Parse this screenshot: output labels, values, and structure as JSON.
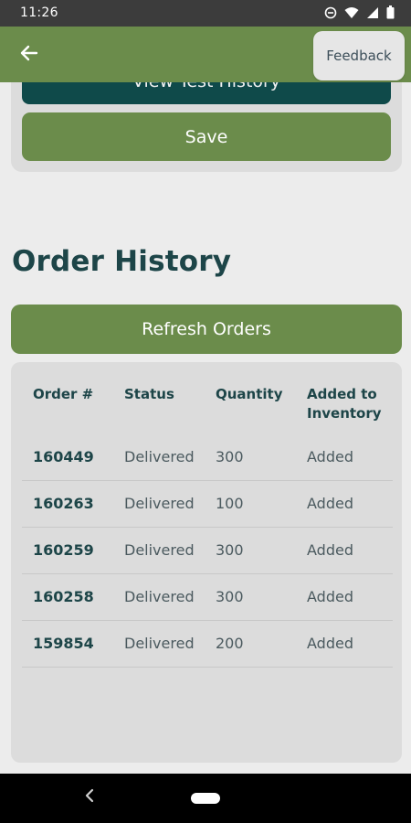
{
  "status_bar": {
    "time": "11:26",
    "icons": [
      "do-not-disturb-icon",
      "wifi-icon",
      "signal-icon",
      "battery-icon"
    ]
  },
  "app_bar": {
    "back_icon": "arrow-left-icon",
    "feedback_label": "Feedback",
    "color": "#6b8c4b"
  },
  "top_card": {
    "view_history_label": "View Test History",
    "save_label": "Save"
  },
  "orders": {
    "title": "Order History",
    "refresh_label": "Refresh Orders",
    "columns": [
      "Order #",
      "Status",
      "Quantity",
      "Added to Inventory"
    ],
    "rows": [
      {
        "order": "160449",
        "status": "Delivered",
        "quantity": "300",
        "added": "Added"
      },
      {
        "order": "160263",
        "status": "Delivered",
        "quantity": "100",
        "added": "Added"
      },
      {
        "order": "160259",
        "status": "Delivered",
        "quantity": "300",
        "added": "Added"
      },
      {
        "order": "160258",
        "status": "Delivered",
        "quantity": "300",
        "added": "Added"
      },
      {
        "order": "159854",
        "status": "Delivered",
        "quantity": "200",
        "added": "Added"
      }
    ]
  },
  "nav_bar": {
    "back_icon": "chevron-left-icon",
    "home_icon": "home-pill-icon"
  }
}
